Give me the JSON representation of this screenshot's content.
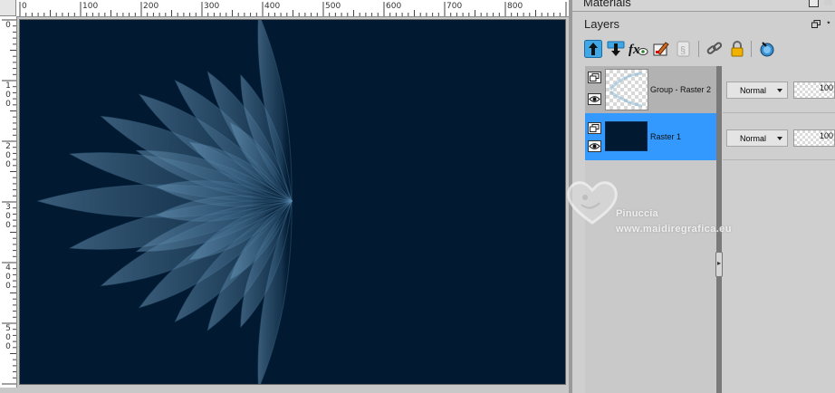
{
  "canvas": {
    "ruler_top_labels": [
      "0",
      "100",
      "200",
      "300",
      "400",
      "500",
      "600",
      "700",
      "800"
    ],
    "ruler_left_labels": [
      [
        "0"
      ],
      [
        "1",
        "0",
        "0"
      ],
      [
        "2",
        "0",
        "0"
      ],
      [
        "3",
        "0",
        "0"
      ],
      [
        "4",
        "0",
        "0"
      ],
      [
        "5",
        "0",
        "0"
      ]
    ],
    "background_color": "#021a31",
    "petal_color": "#5a8bb0"
  },
  "materials": {
    "title": "Materials"
  },
  "layers_panel": {
    "title": "Layers",
    "toolbar": [
      {
        "icon": "move-layer-up-icon"
      },
      {
        "icon": "move-layer-down-icon"
      },
      {
        "icon": "layer-effects-icon"
      },
      {
        "icon": "edit-selection-icon"
      },
      {
        "icon": "protect-transparency-icon"
      },
      {
        "icon": "link-icon"
      },
      {
        "icon": "lock-icon"
      },
      {
        "icon": "layer-styles-icon"
      }
    ],
    "layers": [
      {
        "name": "Group - Raster 2",
        "blend_mode": "Normal",
        "opacity": "100",
        "selected": false
      },
      {
        "name": "Raster 1",
        "blend_mode": "Normal",
        "opacity": "100",
        "selected": true
      }
    ]
  },
  "watermark": {
    "name": "Pinuccia",
    "url": "www.maidiregrafica.eu"
  }
}
